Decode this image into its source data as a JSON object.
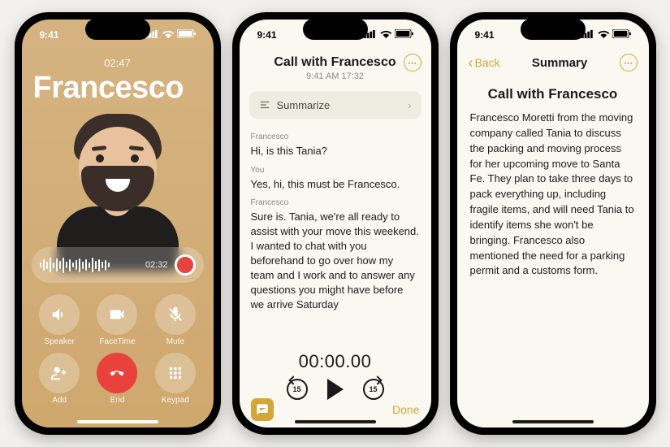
{
  "status_time": "9:41",
  "phone1": {
    "call_duration": "02:47",
    "caller_name": "Francesco",
    "recording_time": "02:32",
    "buttons": {
      "speaker": "Speaker",
      "facetime": "FaceTime",
      "mute": "Mute",
      "add": "Add",
      "end": "End",
      "keypad": "Keypad"
    }
  },
  "phone2": {
    "title": "Call with Francesco",
    "subtitle": "9:41 AM  17:32",
    "summarize_label": "Summarize",
    "transcript": [
      {
        "speaker": "Francesco",
        "text": "Hi, is this Tania?"
      },
      {
        "speaker": "You",
        "text": "Yes, hi, this must be Francesco."
      },
      {
        "speaker": "Francesco",
        "text": "Sure is. Tania, we're all ready to assist with your move this weekend. I wanted to chat with you beforehand to go over how my team and I work and to answer any questions you might have before we arrive Saturday"
      }
    ],
    "player_time": "00:00.00",
    "skip_amount": "15",
    "done_label": "Done"
  },
  "phone3": {
    "back_label": "Back",
    "header": "Summary",
    "title": "Call with Francesco",
    "body": "Francesco Moretti from the moving company called Tania to discuss the packing and moving process for her upcoming move to Santa Fe. They plan to take three days to pack everything up, including fragile items, and will need Tania to identify items she won't be bringing. Francesco also mentioned the need for a parking permit and a customs form."
  }
}
